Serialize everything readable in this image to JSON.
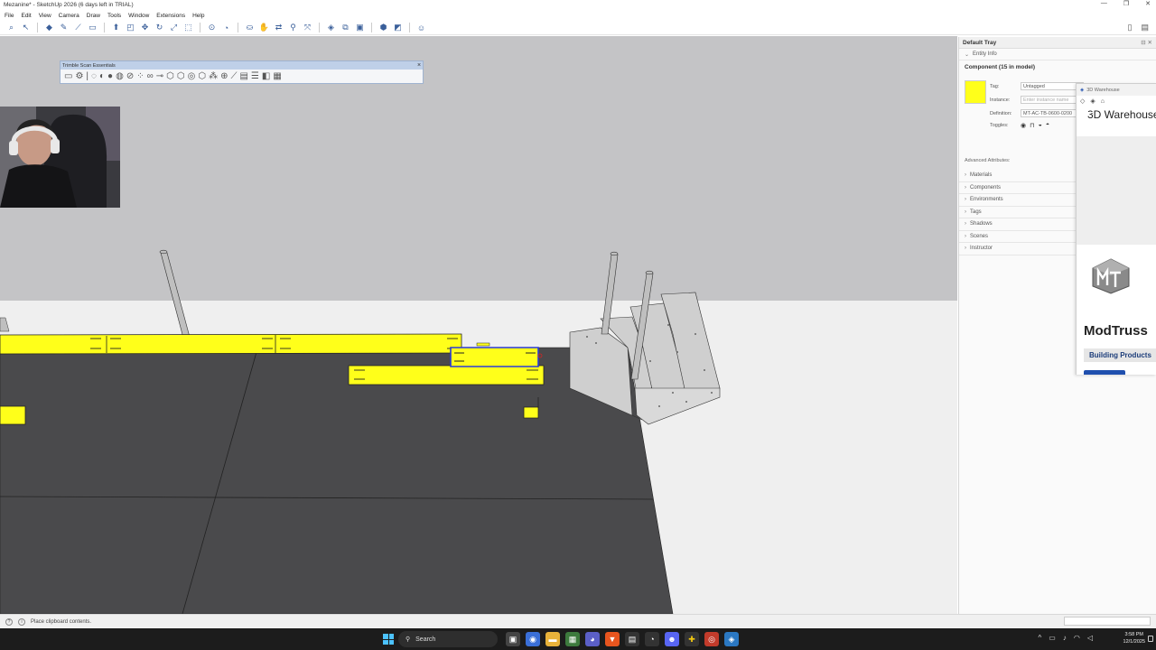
{
  "window": {
    "title": "Mezanine* - SketchUp 2026 (6 days left in TRIAL)",
    "controls": [
      "—",
      "❐",
      "✕"
    ]
  },
  "menu": [
    "File",
    "Edit",
    "View",
    "Camera",
    "Draw",
    "Tools",
    "Window",
    "Extensions",
    "Help"
  ],
  "floating_toolbar": {
    "title": "Trimble Scan Essentials",
    "close": "×"
  },
  "tray": {
    "title": "Default Tray",
    "entity_info": {
      "section": "Entity Info",
      "heading": "Component (15 in model)",
      "tag_label": "Tag:",
      "tag_value": "Untagged",
      "instance_label": "Instance:",
      "instance_placeholder": "Enter instance name",
      "definition_label": "Definition:",
      "definition_value": "MT-AC-TB-0600-0200",
      "toggles_label": "Toggles:",
      "swatch_color": "#ffff1a"
    },
    "advanced_attributes": "Advanced Attributes:",
    "panels": [
      "Materials",
      "Components",
      "Environments",
      "Tags",
      "Shadows",
      "Scenes",
      "Instructor"
    ]
  },
  "warehouse": {
    "bar_title": "3D Warehouse",
    "brand": "3D Warehouse",
    "company": "ModTruss",
    "button": "Building Products"
  },
  "status": {
    "message": "Place clipboard contents."
  },
  "taskbar": {
    "search": "Search",
    "time": "3:58 PM",
    "date": "12/1/2025"
  }
}
